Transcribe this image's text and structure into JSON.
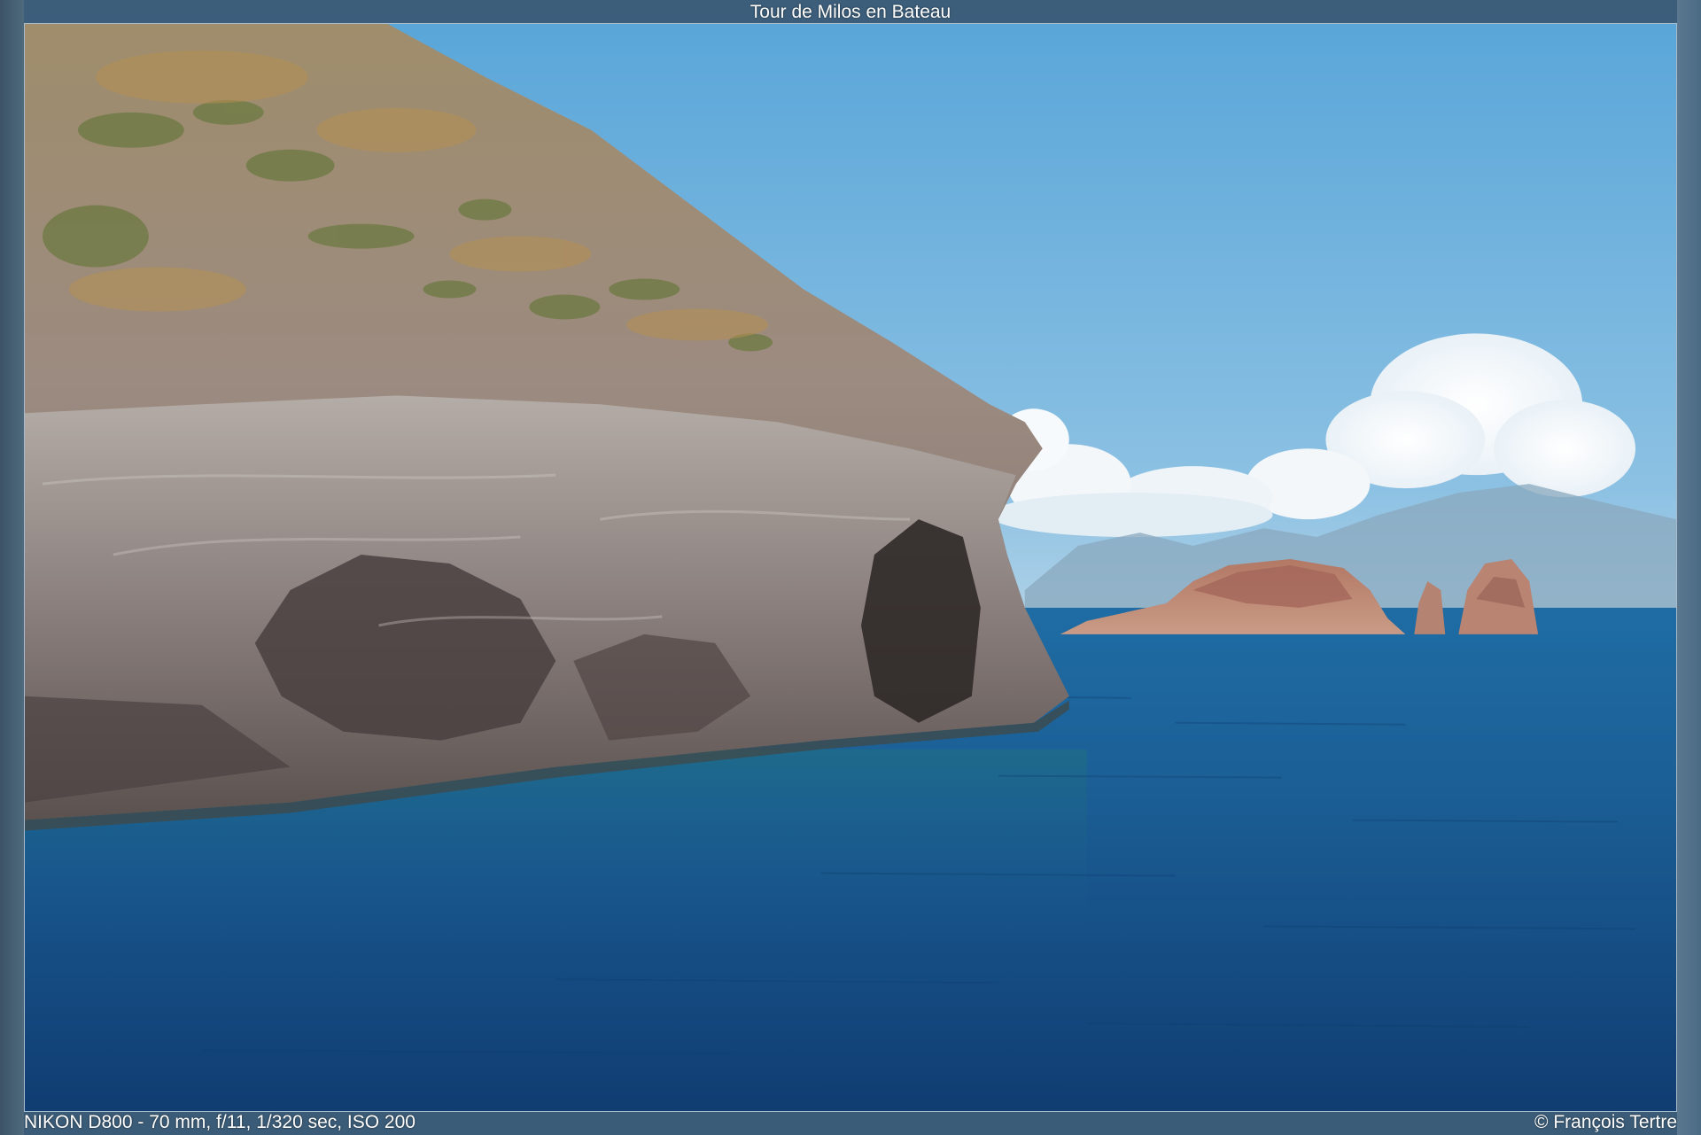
{
  "viewer": {
    "title": "Tour de Milos en Bateau",
    "exif": "NIKON D800 - 70 mm, f/11, 1/320 sec, ISO 200",
    "copyright": "© François Tertre"
  },
  "colors": {
    "frame": "#3f5f7a",
    "sky": "#5fa8d8",
    "sea": "#1c5f96",
    "rock": "#8f8580"
  }
}
